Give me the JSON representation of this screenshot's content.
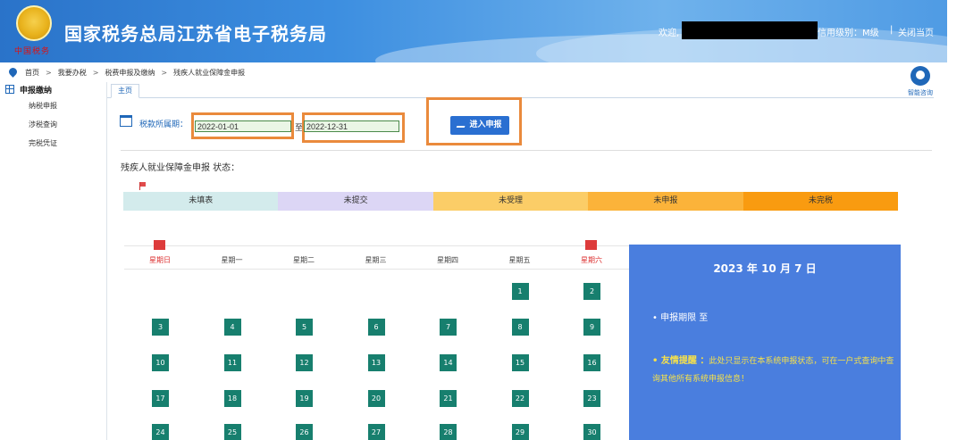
{
  "header": {
    "site_title": "国家税务总局江苏省电子税务局",
    "emblem_text": "中国税务",
    "welcome": "欢迎,",
    "credit": "信用级别：M级",
    "separator": "|",
    "close_page": "关闭当页"
  },
  "breadcrumb": {
    "home": "首页",
    "arrow": ">",
    "level1": "我要办税",
    "level2": "税费申报及缴纳",
    "level3": "残疾人就业保障金申报"
  },
  "help": {
    "label": "智能咨询",
    "icon": "customer-service-icon"
  },
  "sidebar": {
    "title": "申报缴纳",
    "items": [
      {
        "label": "纳税申报"
      },
      {
        "label": "涉税查询"
      },
      {
        "label": "完税凭证"
      }
    ]
  },
  "tabs": [
    {
      "label": "主页"
    }
  ],
  "period": {
    "label": "税款所属期：",
    "start": "2022-01-01",
    "to": "至",
    "end": "2022-12-31",
    "button": "进入申报"
  },
  "status": {
    "title": "残疾人就业保障金申报 状态：",
    "segments": [
      {
        "label": "未填表",
        "color": "#d3ebec"
      },
      {
        "label": "未提交",
        "color": "#dcd6f5"
      },
      {
        "label": "未受理",
        "color": "#fbcd67"
      },
      {
        "label": "未申报",
        "color": "#fbb33a"
      },
      {
        "label": "未完税",
        "color": "#f99b10"
      }
    ]
  },
  "calendar": {
    "weekdays": [
      "星期日",
      "星期一",
      "星期二",
      "星期三",
      "星期四",
      "星期五",
      "星期六"
    ],
    "weeks": [
      [
        "",
        "",
        "",
        "",
        "",
        "1",
        "2"
      ],
      [
        "3",
        "4",
        "5",
        "6",
        "7",
        "8",
        "9"
      ],
      [
        "10",
        "11",
        "12",
        "13",
        "14",
        "15",
        "16"
      ],
      [
        "17",
        "18",
        "19",
        "20",
        "21",
        "22",
        "23"
      ],
      [
        "24",
        "25",
        "26",
        "27",
        "28",
        "29",
        "30"
      ]
    ]
  },
  "info": {
    "date": "2023 年 10 月 7 日",
    "deadline": "• 申报期限  至",
    "tip_key": "• 友情提醒 ：",
    "tip_text": "此处只显示在本系统申报状态，可在一户式查询中查询其他所有系统申报信息！"
  },
  "colors": {
    "header_blue": "#2a73c9",
    "highlight_orange": "#ea8a3c",
    "day_green": "#177f6e",
    "panel_blue": "#4a7ede",
    "button_blue": "#2a6fd1"
  }
}
